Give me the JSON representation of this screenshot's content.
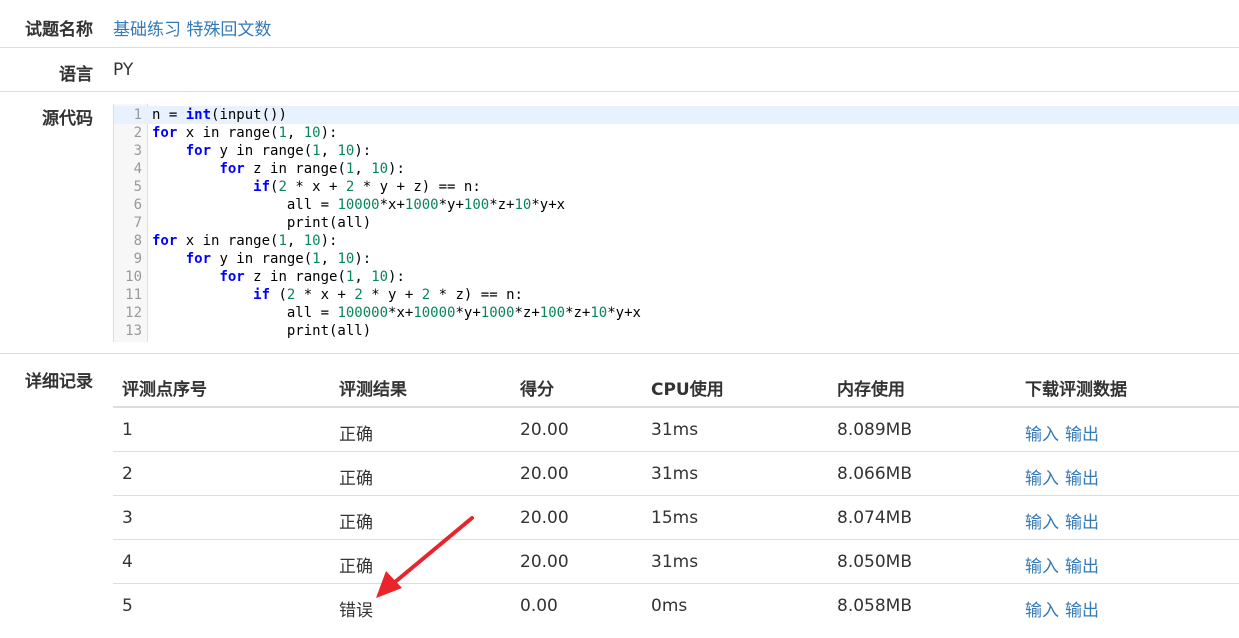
{
  "problem": {
    "label": "试题名称",
    "value": "基础练习 特殊回文数"
  },
  "language": {
    "label": "语言",
    "value": "PY"
  },
  "source": {
    "label": "源代码",
    "lines": [
      [
        [
          "n = ",
          ""
        ],
        [
          "int",
          "kw"
        ],
        [
          "(input())",
          ""
        ]
      ],
      [
        [
          "for",
          "kw"
        ],
        [
          " x in range(",
          ""
        ],
        [
          "1",
          "num"
        ],
        [
          ", ",
          ""
        ],
        [
          "10",
          "num"
        ],
        [
          "):",
          ""
        ]
      ],
      [
        [
          "    ",
          ""
        ],
        [
          "for",
          "kw"
        ],
        [
          " y in range(",
          ""
        ],
        [
          "1",
          "num"
        ],
        [
          ", ",
          ""
        ],
        [
          "10",
          "num"
        ],
        [
          "):",
          ""
        ]
      ],
      [
        [
          "        ",
          ""
        ],
        [
          "for",
          "kw"
        ],
        [
          " z in range(",
          ""
        ],
        [
          "1",
          "num"
        ],
        [
          ", ",
          ""
        ],
        [
          "10",
          "num"
        ],
        [
          "):",
          ""
        ]
      ],
      [
        [
          "            ",
          ""
        ],
        [
          "if",
          "kw"
        ],
        [
          "(",
          ""
        ],
        [
          "2",
          "num"
        ],
        [
          " * x + ",
          ""
        ],
        [
          "2",
          "num"
        ],
        [
          " * y + z) == n:",
          ""
        ]
      ],
      [
        [
          "                all = ",
          ""
        ],
        [
          "10000",
          "num"
        ],
        [
          "*x+",
          ""
        ],
        [
          "1000",
          "num"
        ],
        [
          "*y+",
          ""
        ],
        [
          "100",
          "num"
        ],
        [
          "*z+",
          ""
        ],
        [
          "10",
          "num"
        ],
        [
          "*y+x",
          ""
        ]
      ],
      [
        [
          "                print(all)",
          ""
        ]
      ],
      [
        [
          "for",
          "kw"
        ],
        [
          " x in range(",
          ""
        ],
        [
          "1",
          "num"
        ],
        [
          ", ",
          ""
        ],
        [
          "10",
          "num"
        ],
        [
          "):",
          ""
        ]
      ],
      [
        [
          "    ",
          ""
        ],
        [
          "for",
          "kw"
        ],
        [
          " y in range(",
          ""
        ],
        [
          "1",
          "num"
        ],
        [
          ", ",
          ""
        ],
        [
          "10",
          "num"
        ],
        [
          "):",
          ""
        ]
      ],
      [
        [
          "        ",
          ""
        ],
        [
          "for",
          "kw"
        ],
        [
          " z in range(",
          ""
        ],
        [
          "1",
          "num"
        ],
        [
          ", ",
          ""
        ],
        [
          "10",
          "num"
        ],
        [
          "):",
          ""
        ]
      ],
      [
        [
          "            ",
          ""
        ],
        [
          "if",
          "kw"
        ],
        [
          " (",
          ""
        ],
        [
          "2",
          "num"
        ],
        [
          " * x + ",
          ""
        ],
        [
          "2",
          "num"
        ],
        [
          " * y + ",
          ""
        ],
        [
          "2",
          "num"
        ],
        [
          " * z) == n:",
          ""
        ]
      ],
      [
        [
          "                all = ",
          ""
        ],
        [
          "100000",
          "num"
        ],
        [
          "*x+",
          ""
        ],
        [
          "10000",
          "num"
        ],
        [
          "*y+",
          ""
        ],
        [
          "1000",
          "num"
        ],
        [
          "*z+",
          ""
        ],
        [
          "100",
          "num"
        ],
        [
          "*z+",
          ""
        ],
        [
          "10",
          "num"
        ],
        [
          "*y+x",
          ""
        ]
      ],
      [
        [
          "                print(all)",
          ""
        ]
      ]
    ]
  },
  "details": {
    "label": "详细记录",
    "headers": [
      "评测点序号",
      "评测结果",
      "得分",
      "CPU使用",
      "内存使用",
      "下载评测数据"
    ],
    "rows": [
      {
        "id": "1",
        "result": "正确",
        "score": "20.00",
        "cpu": "31ms",
        "mem": "8.089MB",
        "in": "输入",
        "out": "输出"
      },
      {
        "id": "2",
        "result": "正确",
        "score": "20.00",
        "cpu": "31ms",
        "mem": "8.066MB",
        "in": "输入",
        "out": "输出"
      },
      {
        "id": "3",
        "result": "正确",
        "score": "20.00",
        "cpu": "15ms",
        "mem": "8.074MB",
        "in": "输入",
        "out": "输出"
      },
      {
        "id": "4",
        "result": "正确",
        "score": "20.00",
        "cpu": "31ms",
        "mem": "8.050MB",
        "in": "输入",
        "out": "输出"
      },
      {
        "id": "5",
        "result": "错误",
        "score": "0.00",
        "cpu": "0ms",
        "mem": "8.058MB",
        "in": "输入",
        "out": "输出"
      }
    ]
  },
  "colors": {
    "link": "#337ab7",
    "keyword": "#0000ff",
    "number": "#098658",
    "arrow": "#e8252b"
  },
  "icons": {
    "annotation": "red-arrow-icon"
  }
}
